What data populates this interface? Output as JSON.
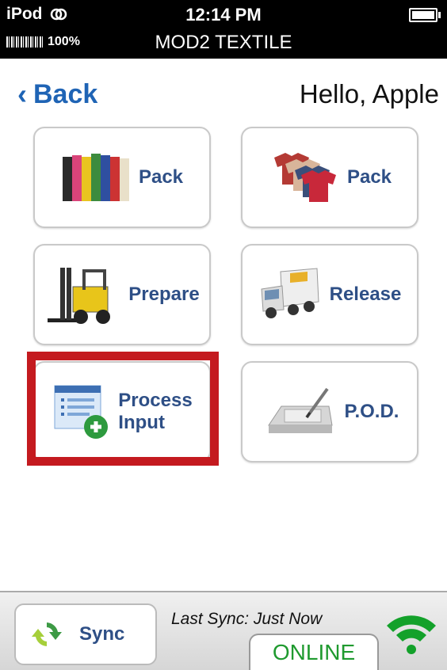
{
  "status_bar": {
    "device": "iPod",
    "time": "12:14 PM",
    "battery_percent": "100%",
    "app_title": "MOD2 TEXTILE"
  },
  "nav": {
    "back_label": "Back",
    "greeting": "Hello, Apple"
  },
  "tiles": [
    {
      "label": "Pack",
      "icon": "fabric-rolls-icon"
    },
    {
      "label": "Pack",
      "icon": "tshirts-icon"
    },
    {
      "label": "Prepare",
      "icon": "forklift-icon"
    },
    {
      "label": "Release",
      "icon": "truck-icon"
    },
    {
      "label": "Process\nInput",
      "line1": "Process",
      "line2": "Input",
      "icon": "document-add-icon"
    },
    {
      "label": "P.O.D.",
      "icon": "signature-pad-icon"
    }
  ],
  "footer": {
    "sync_label": "Sync",
    "last_sync": "Last Sync: Just Now",
    "status": "ONLINE"
  },
  "colors": {
    "accent": "#1f64b5",
    "tile_label": "#2e4f86",
    "highlight": "#c41a1f",
    "online": "#1f9a2f"
  }
}
